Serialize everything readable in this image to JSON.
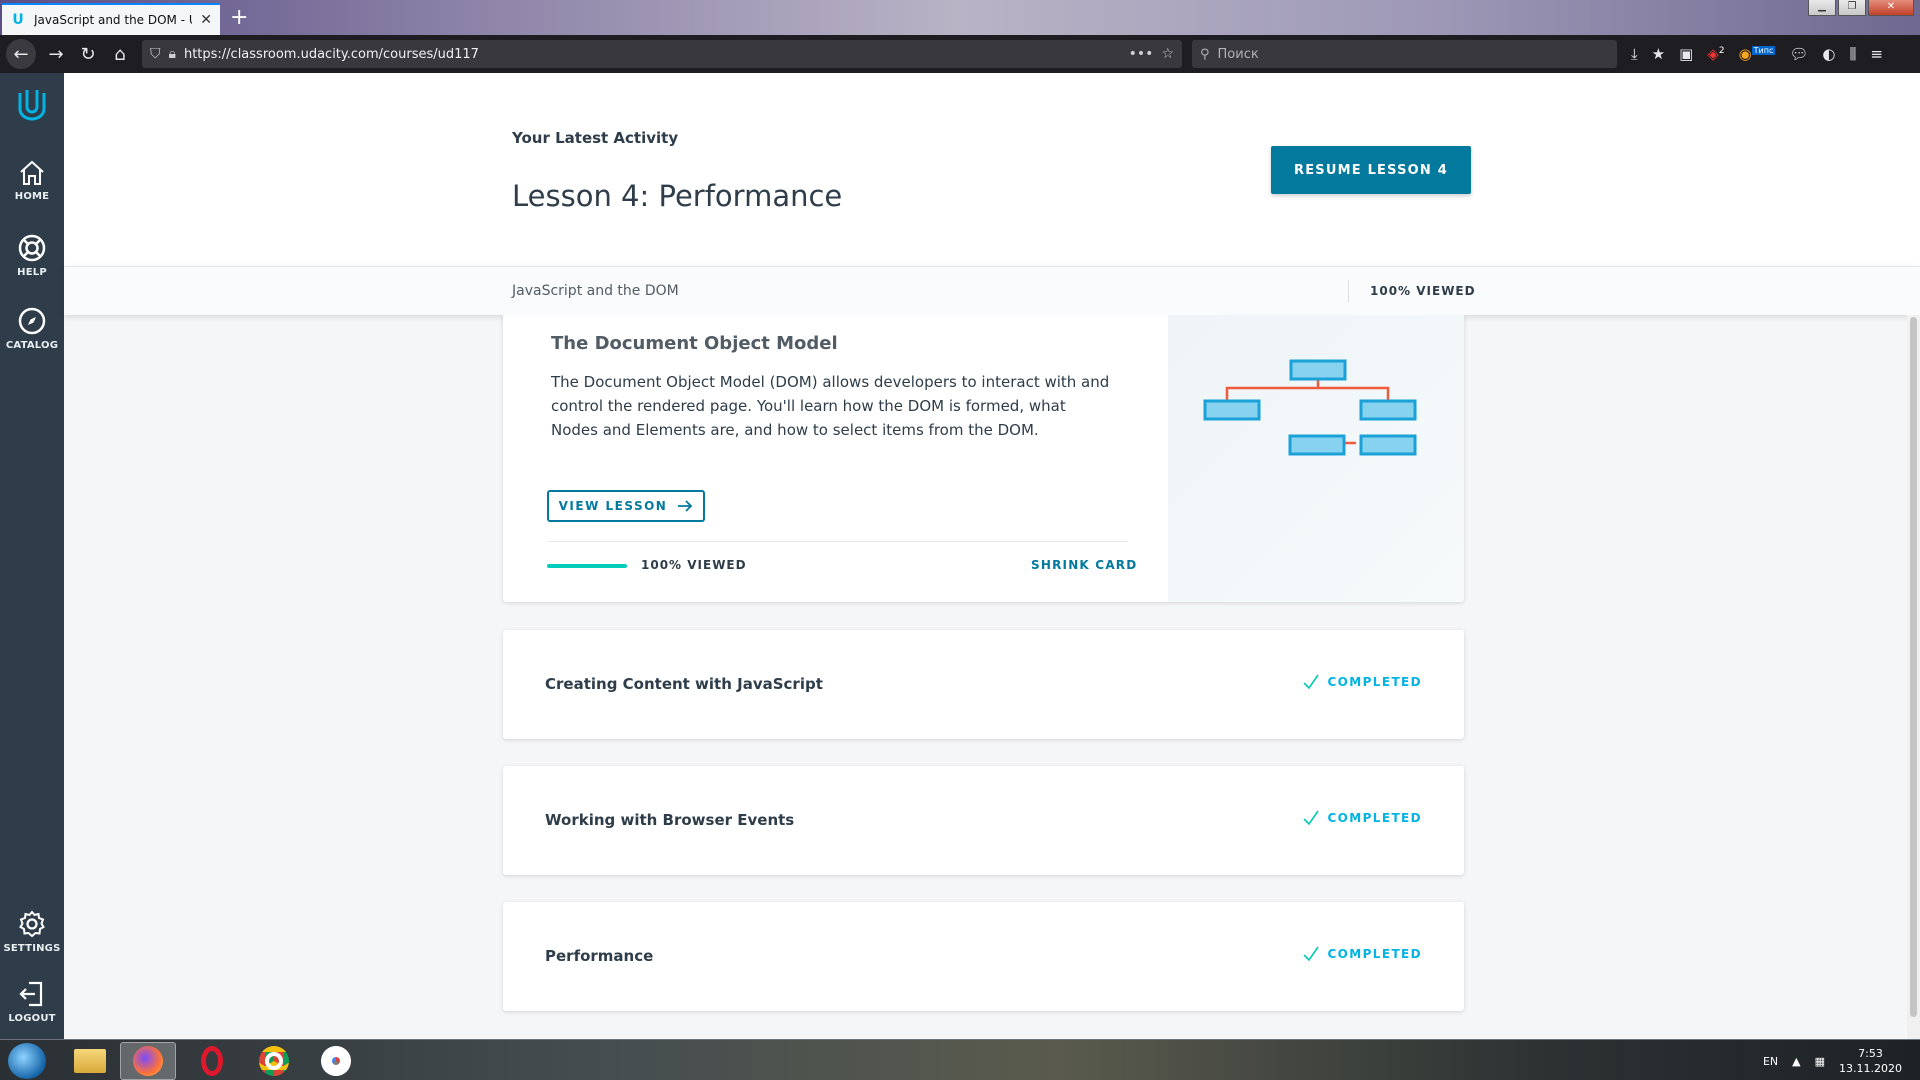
{
  "browser": {
    "tab_title": "JavaScript and the DOM - Udacity",
    "url": "https://classroom.udacity.com/courses/ud117",
    "search_placeholder": "Поиск",
    "window_controls": [
      "minimize",
      "restore",
      "close"
    ],
    "badges": {
      "ublock": "2",
      "extension": "Типс"
    }
  },
  "sidebar": {
    "items": [
      {
        "label": "HOME",
        "icon": "home-icon"
      },
      {
        "label": "HELP",
        "icon": "lifebuoy-icon"
      },
      {
        "label": "CATALOG",
        "icon": "compass-icon"
      },
      {
        "label": "SETTINGS",
        "icon": "gear-icon"
      },
      {
        "label": "LOGOUT",
        "icon": "logout-icon"
      }
    ]
  },
  "activity": {
    "label": "Your Latest Activity",
    "lesson": "Lesson 4: Performance",
    "resume_label": "RESUME LESSON 4"
  },
  "course": {
    "name": "JavaScript and the DOM",
    "progress_label": "100% VIEWED",
    "progress_fraction": 1.0
  },
  "expanded_card": {
    "title": "The Document Object Model",
    "description": "The Document Object Model (DOM) allows developers to interact with and control the rendered page. You'll learn how the DOM is formed, what Nodes and Elements are, and how to select items from the DOM.",
    "view_label": "VIEW LESSON",
    "progress_label": "100% VIEWED",
    "progress_fraction": 1.0,
    "shrink_label": "SHRINK CARD"
  },
  "lessons": [
    {
      "title": "Creating Content with JavaScript",
      "status": "COMPLETED"
    },
    {
      "title": "Working with Browser Events",
      "status": "COMPLETED"
    },
    {
      "title": "Performance",
      "status": "COMPLETED"
    }
  ],
  "taskbar": {
    "language": "EN",
    "time": "7:53",
    "date": "13.11.2020"
  },
  "colors": {
    "sidebar": "#2e3d49",
    "primary_button": "#02799d",
    "accent": "#02b3e4",
    "progress": "#02ccba",
    "diagram_fill": "#87d3ef",
    "diagram_stroke": "#1aa2d8",
    "diagram_connector": "#f15a3c"
  }
}
